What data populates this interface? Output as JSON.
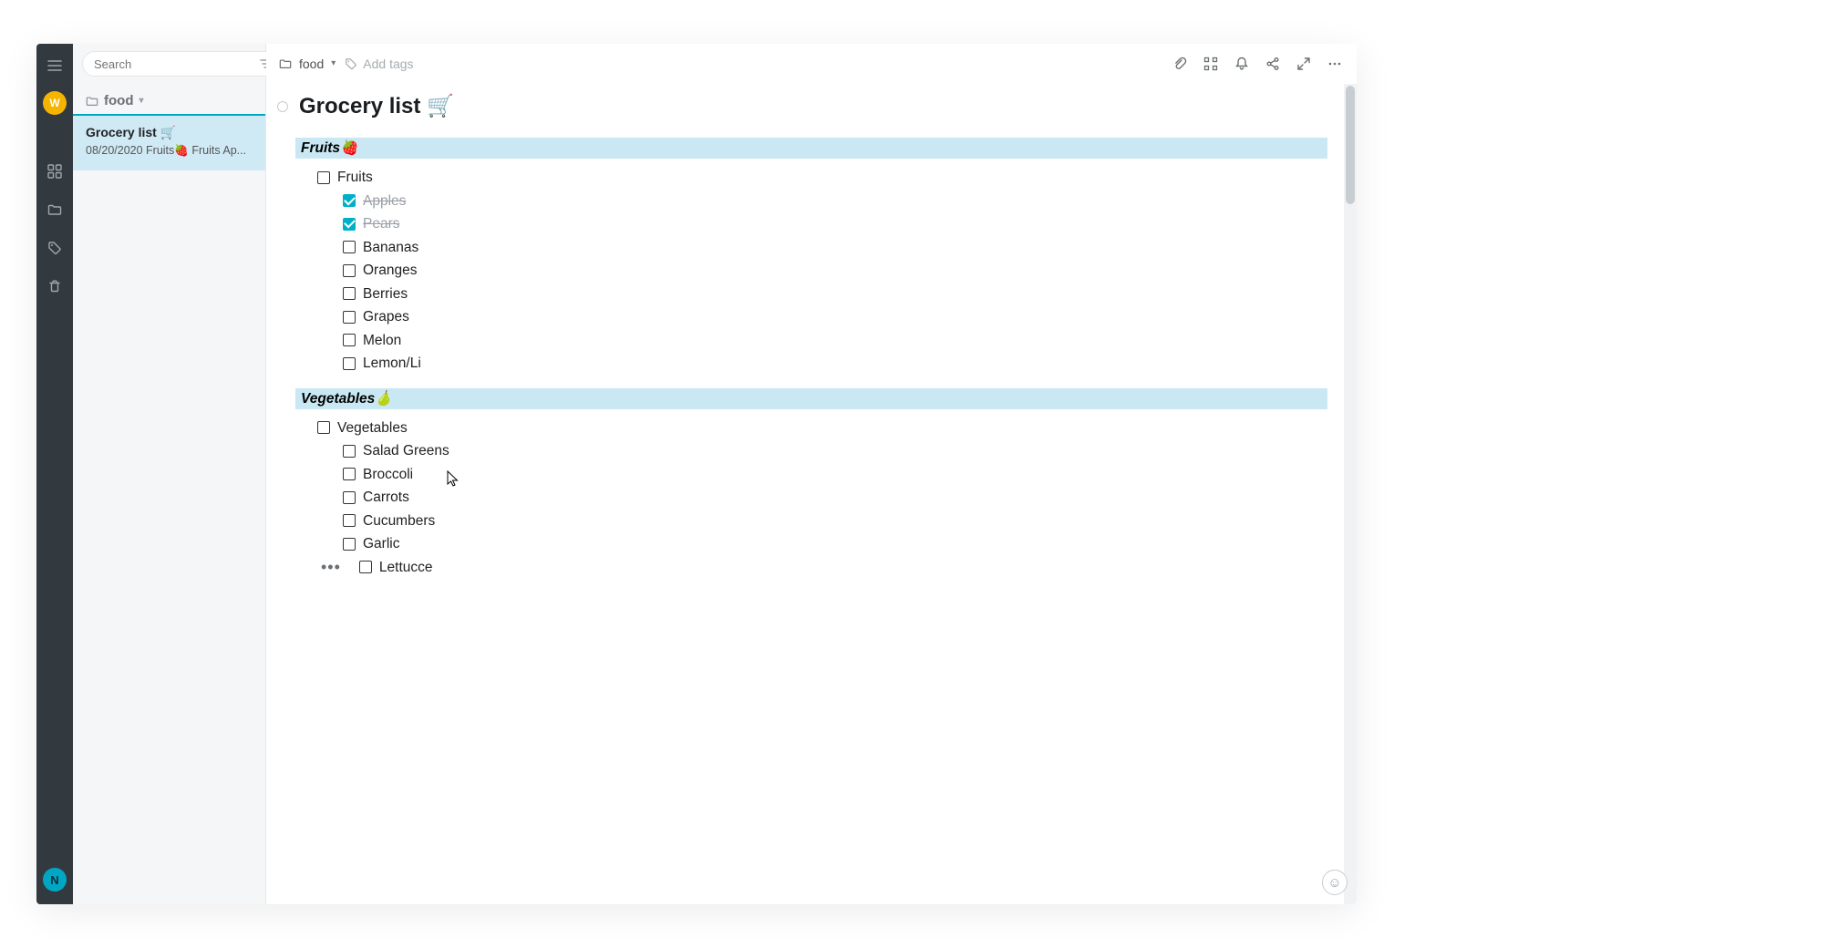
{
  "rail": {
    "avatar_initial": "W",
    "logo_initial": "N"
  },
  "sidebar": {
    "search_placeholder": "Search",
    "breadcrumb_folder": "food",
    "note_card": {
      "title": "Grocery list 🛒",
      "preview": "08/20/2020 Fruits🍓 Fruits Ap..."
    }
  },
  "topbar": {
    "breadcrumb_folder": "food",
    "tags_placeholder": "Add tags"
  },
  "page": {
    "title": "Grocery list 🛒"
  },
  "sections": [
    {
      "heading": "Fruits🍓",
      "group_label": "Fruits",
      "items": [
        {
          "label": "Apples",
          "checked": true
        },
        {
          "label": "Pears",
          "checked": true
        },
        {
          "label": "Bananas",
          "checked": false
        },
        {
          "label": "Oranges",
          "checked": false
        },
        {
          "label": "Berries",
          "checked": false
        },
        {
          "label": "Grapes",
          "checked": false
        },
        {
          "label": "Melon",
          "checked": false
        },
        {
          "label": "Lemon/Li",
          "checked": false
        }
      ]
    },
    {
      "heading": "Vegetables🍐",
      "group_label": "Vegetables",
      "items": [
        {
          "label": "Salad Greens",
          "checked": false
        },
        {
          "label": "Broccoli",
          "checked": false
        },
        {
          "label": "Carrots",
          "checked": false
        },
        {
          "label": "Cucumbers",
          "checked": false
        },
        {
          "label": "Garlic",
          "checked": false
        },
        {
          "label": "Lettucce",
          "checked": false
        }
      ]
    }
  ]
}
